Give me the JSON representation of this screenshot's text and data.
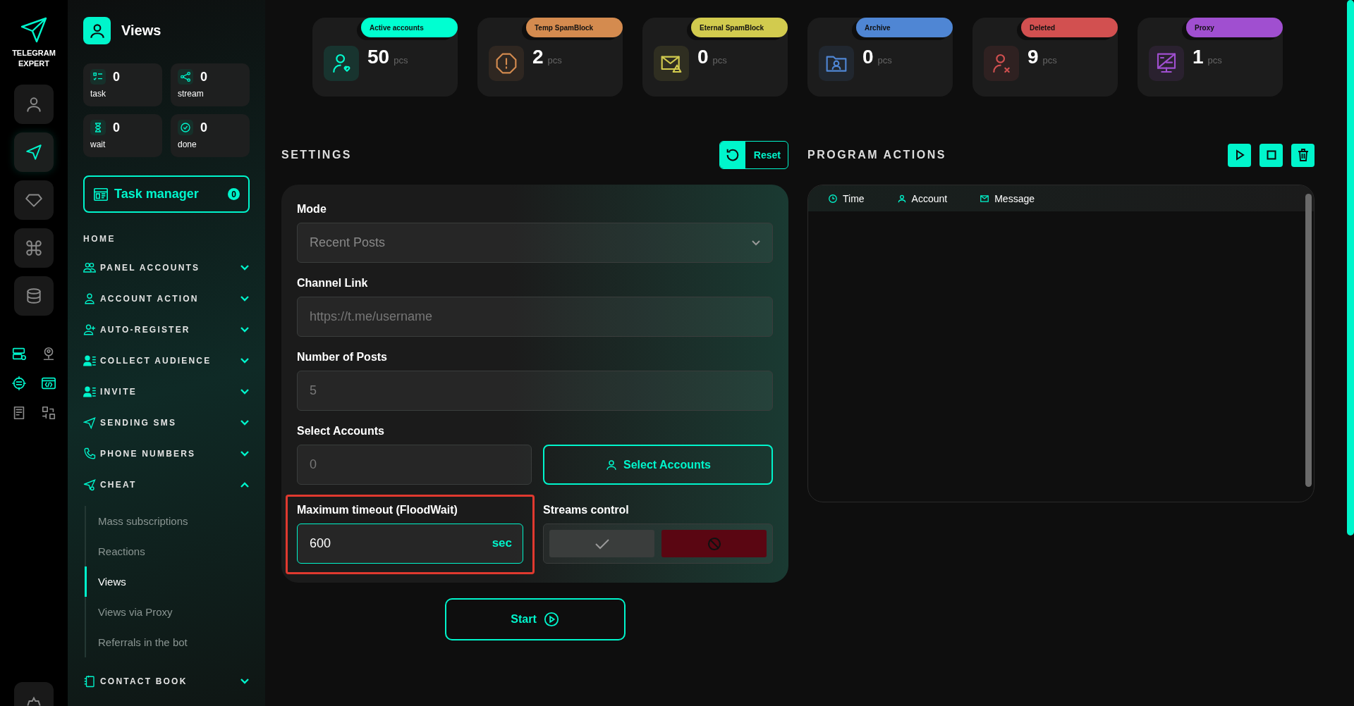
{
  "logo": {
    "title": "TELEGRAM EXPERT"
  },
  "rail": {
    "tiles": [
      {
        "selected": false
      },
      {
        "selected": true
      },
      {
        "selected": false
      },
      {
        "selected": false
      },
      {
        "selected": false
      }
    ],
    "tools": [
      {
        "active": true
      },
      {
        "active": false
      },
      {
        "active": true
      },
      {
        "active": true
      },
      {
        "active": false
      },
      {
        "active": false
      }
    ]
  },
  "page": {
    "title": "Views"
  },
  "counters": [
    {
      "value": "0",
      "label": "task"
    },
    {
      "value": "0",
      "label": "stream"
    },
    {
      "value": "0",
      "label": "wait"
    },
    {
      "value": "0",
      "label": "done"
    }
  ],
  "task_manager": {
    "label": "Task manager",
    "count": "0"
  },
  "nav": {
    "home": "HOME",
    "items": [
      {
        "label": "PANEL ACCOUNTS",
        "expanded": false
      },
      {
        "label": "ACCOUNT ACTION",
        "expanded": false
      },
      {
        "label": "AUTO-REGISTER",
        "expanded": false
      },
      {
        "label": "COLLECT AUDIENCE",
        "expanded": false
      },
      {
        "label": "INVITE",
        "expanded": false
      },
      {
        "label": "SENDING SMS",
        "expanded": false
      },
      {
        "label": "PHONE NUMBERS",
        "expanded": false
      },
      {
        "label": "CHEAT",
        "expanded": true,
        "children": [
          {
            "label": "Mass subscriptions",
            "selected": false
          },
          {
            "label": "Reactions",
            "selected": false
          },
          {
            "label": "Views",
            "selected": true
          },
          {
            "label": "Views via Proxy",
            "selected": false
          },
          {
            "label": "Referrals in the bot",
            "selected": false
          }
        ]
      },
      {
        "label": "CONTACT BOOK",
        "expanded": false
      }
    ]
  },
  "stats": [
    {
      "label": "Active accounts",
      "value": "50",
      "unit": "pcs",
      "color": "#00ffd1"
    },
    {
      "label": "Temp SpamBlock",
      "value": "2",
      "unit": "pcs",
      "color": "#d48b4f"
    },
    {
      "label": "Eternal SpamBlock",
      "value": "0",
      "unit": "pcs",
      "color": "#d2cb4e"
    },
    {
      "label": "Archive",
      "value": "0",
      "unit": "pcs",
      "color": "#4f86d4"
    },
    {
      "label": "Deleted",
      "value": "9",
      "unit": "pcs",
      "color": "#d25050"
    },
    {
      "label": "Proxy",
      "value": "1",
      "unit": "pcs",
      "color": "#a04fd0"
    }
  ],
  "settings": {
    "title": "SETTINGS",
    "reset": "Reset",
    "mode": {
      "label": "Mode",
      "value": "Recent Posts"
    },
    "channel_link": {
      "label": "Channel Link",
      "placeholder": "https://t.me/username"
    },
    "number_of_posts": {
      "label": "Number of Posts",
      "placeholder": "5"
    },
    "select_accounts": {
      "label": "Select Accounts",
      "placeholder": "0",
      "button": "Select Accounts"
    },
    "timeout": {
      "label": "Maximum timeout (FloodWait)",
      "value": "600",
      "unit": "sec",
      "highlighted": true,
      "focused": true
    },
    "streams_control": {
      "label": "Streams control"
    },
    "start": "Start"
  },
  "program_actions": {
    "title": "PROGRAM ACTIONS",
    "columns": [
      "Time",
      "Account",
      "Message"
    ]
  }
}
